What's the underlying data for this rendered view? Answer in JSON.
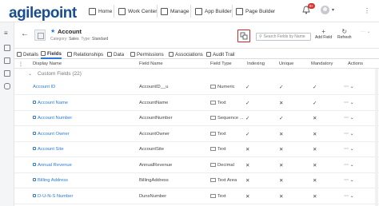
{
  "brand": {
    "logo_text": "agilepoint"
  },
  "topnav": {
    "items": [
      {
        "label": "Home",
        "icon": "home-icon"
      },
      {
        "label": "Work Center",
        "icon": "work-center-icon"
      },
      {
        "label": "Manage",
        "icon": "manage-icon"
      },
      {
        "label": "App Builder",
        "icon": "app-builder-icon"
      },
      {
        "label": "Page Builder",
        "icon": "page-builder-icon"
      }
    ],
    "notifications_badge": "8+"
  },
  "header": {
    "title": "Account",
    "category_label": "Category:",
    "category_value": "Sales",
    "type_label": "Type:",
    "type_value": "Standard",
    "search_placeholder": "Search Fields by Name",
    "add_field_label": "Add Field",
    "refresh_label": "Refresh"
  },
  "tabs": [
    {
      "label": "Details",
      "active": false
    },
    {
      "label": "Fields",
      "active": true
    },
    {
      "label": "Relationships",
      "active": false
    },
    {
      "label": "Data",
      "active": false
    },
    {
      "label": "Permissions",
      "active": false
    },
    {
      "label": "Associations",
      "active": false
    },
    {
      "label": "Audit Trail",
      "active": false
    }
  ],
  "table": {
    "columns": [
      "Display Name",
      "Field Name",
      "Field Type",
      "Indexing",
      "Unique",
      "Mandatory",
      "Actions"
    ],
    "group_label": "Custom Fields (22)",
    "rows": [
      {
        "display": "Account ID",
        "field": "AccountID__u",
        "type": "Numeric",
        "indexing": "check",
        "unique": "check",
        "mandatory": "check",
        "locked": false
      },
      {
        "display": "Account Name",
        "field": "AccountName",
        "type": "Text",
        "indexing": "check",
        "unique": "cross",
        "mandatory": "check",
        "locked": true
      },
      {
        "display": "Account Number",
        "field": "AccountNumber",
        "type": "Sequence ...",
        "indexing": "check",
        "unique": "check",
        "mandatory": "cross",
        "locked": true
      },
      {
        "display": "Account Owner",
        "field": "AccountOwner",
        "type": "Text",
        "indexing": "check",
        "unique": "cross",
        "mandatory": "cross",
        "locked": true
      },
      {
        "display": "Account Site",
        "field": "AccountSite",
        "type": "Text",
        "indexing": "cross",
        "unique": "cross",
        "mandatory": "cross",
        "locked": true
      },
      {
        "display": "Annual Revenue",
        "field": "AnnualRevenue",
        "type": "Decimal",
        "indexing": "cross",
        "unique": "cross",
        "mandatory": "cross",
        "locked": true
      },
      {
        "display": "Billing Address",
        "field": "BillingAddress",
        "type": "Text Area",
        "indexing": "cross",
        "unique": "cross",
        "mandatory": "cross",
        "locked": true
      },
      {
        "display": "D-U-N-S Number",
        "field": "DunsNumber",
        "type": "Text",
        "indexing": "cross",
        "unique": "cross",
        "mandatory": "cross",
        "locked": true
      }
    ]
  }
}
